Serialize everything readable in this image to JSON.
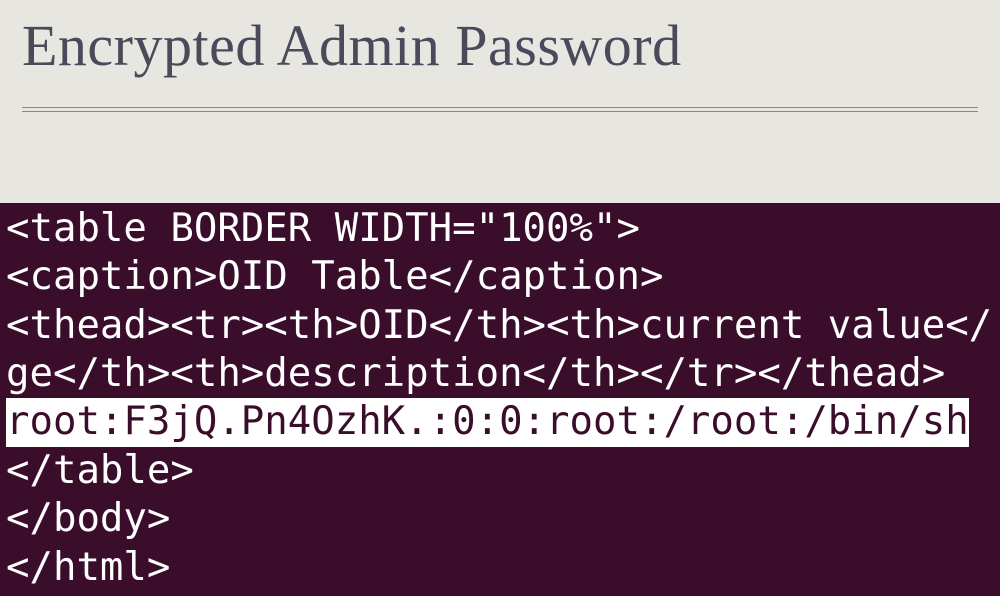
{
  "title": "Encrypted Admin Password",
  "code": {
    "line1": "<table BORDER WIDTH=\"100%\">",
    "line2": "<caption>OID Table</caption>",
    "line3": "<thead><tr><th>OID</th><th>current value</",
    "line4": "ge</th><th>description</th></tr></thead>",
    "line5": "root:F3jQ.Pn4OzhK.:0:0:root:/root:/bin/sh",
    "line6": "</table>",
    "line7": "</body>",
    "line8": "</html>"
  }
}
